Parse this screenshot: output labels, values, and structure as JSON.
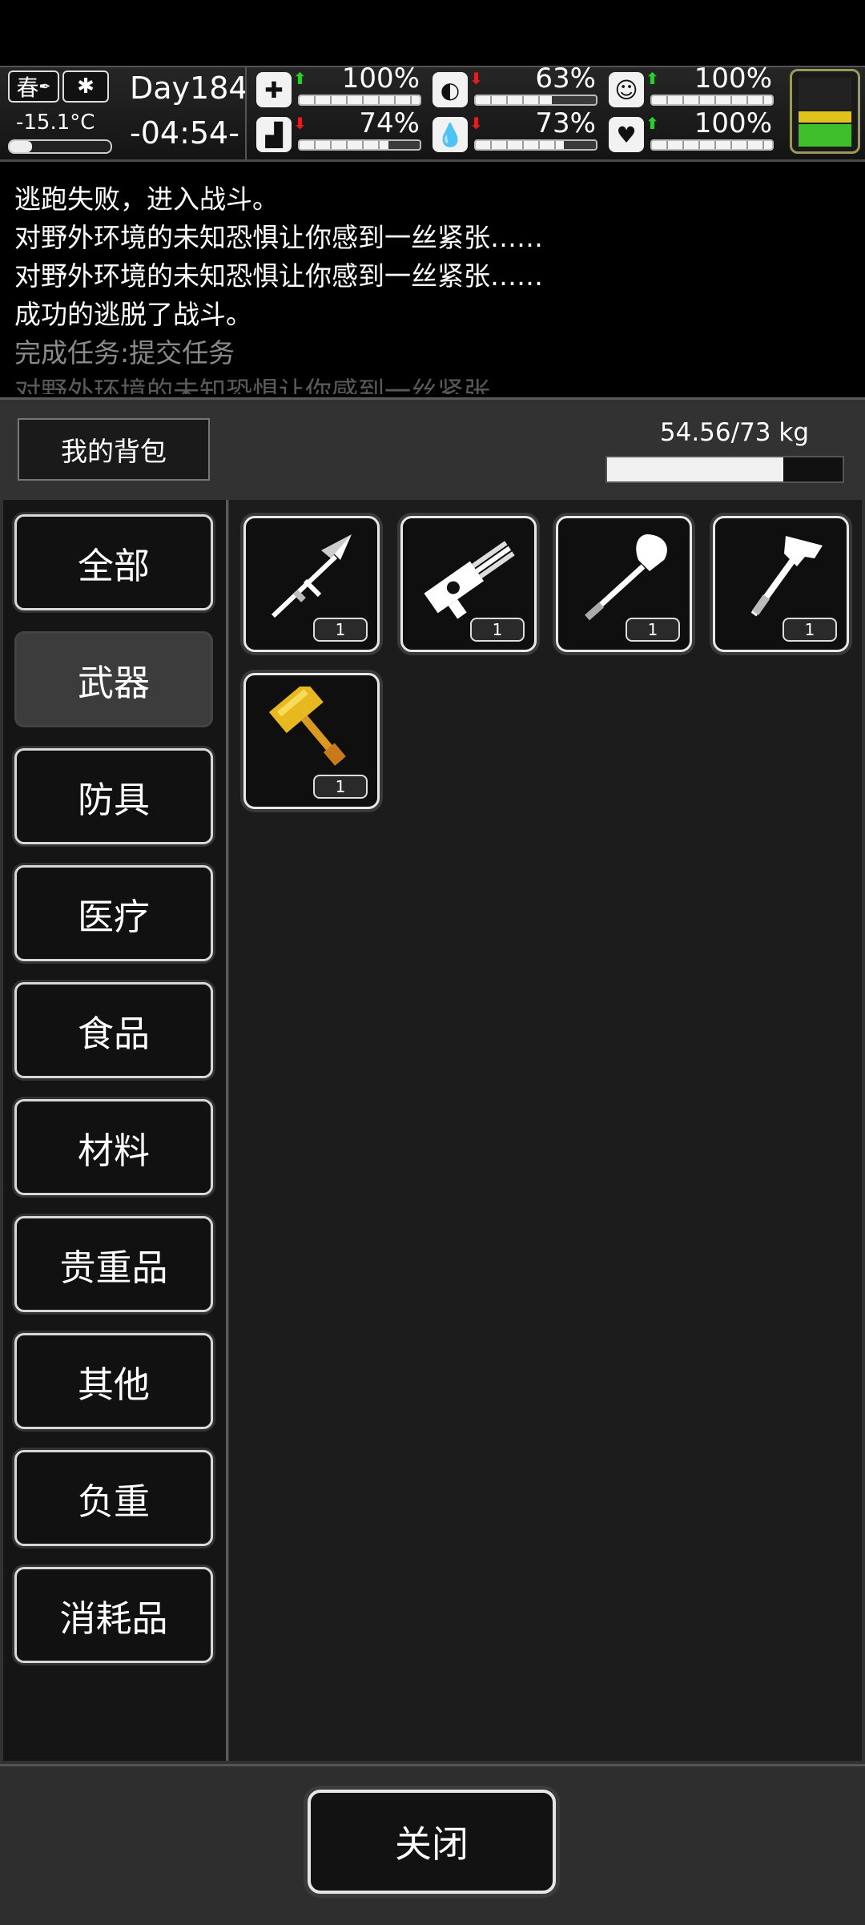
{
  "hud": {
    "season": "春",
    "temperature": "-15.1°C",
    "day": "Day184",
    "time": "-04:54-",
    "stats": [
      {
        "icon": "medkit-icon",
        "arrow": "up",
        "value": "100%",
        "level": 1.0
      },
      {
        "icon": "stomach-icon",
        "arrow": "down",
        "value": "63%",
        "level": 0.63
      },
      {
        "icon": "mood-icon",
        "arrow": "up",
        "value": "100%",
        "level": 1.0
      },
      {
        "icon": "boot-icon",
        "arrow": "down",
        "value": "74%",
        "level": 0.74
      },
      {
        "icon": "water-drop-icon",
        "arrow": "down",
        "value": "73%",
        "level": 0.73
      },
      {
        "icon": "heart-icon",
        "arrow": "up",
        "value": "100%",
        "level": 1.0
      }
    ]
  },
  "log": {
    "lines": [
      "逃跑失败，进入战斗。",
      "对野外环境的未知恐惧让你感到一丝紧张……",
      "对野外环境的未知恐惧让你感到一丝紧张……",
      "成功的逃脱了战斗。",
      "完成任务:提交任务",
      "对野外环境的未知恐惧让你感到一丝紧张……"
    ]
  },
  "bag": {
    "title": "我的背包",
    "weight": "54.56/73 kg",
    "weight_level": 0.747
  },
  "categories": [
    "全部",
    "武器",
    "防具",
    "医疗",
    "食品",
    "材料",
    "贵重品",
    "其他",
    "负重",
    "消耗品"
  ],
  "active_category": "武器",
  "items": [
    {
      "icon": "spear-icon",
      "qty": "1"
    },
    {
      "icon": "minigun-icon",
      "qty": "1"
    },
    {
      "icon": "shovel-icon",
      "qty": "1"
    },
    {
      "icon": "axe-icon",
      "qty": "1"
    },
    {
      "icon": "golden-hammer-icon",
      "qty": "1"
    }
  ],
  "close_label": "关闭",
  "colors": {
    "arrow_up": "#2ecc2e",
    "arrow_down": "#e02020",
    "battery_yellow": "#e0c21a",
    "battery_green": "#3fbf2a",
    "hammer_gold": "#e8b820"
  }
}
